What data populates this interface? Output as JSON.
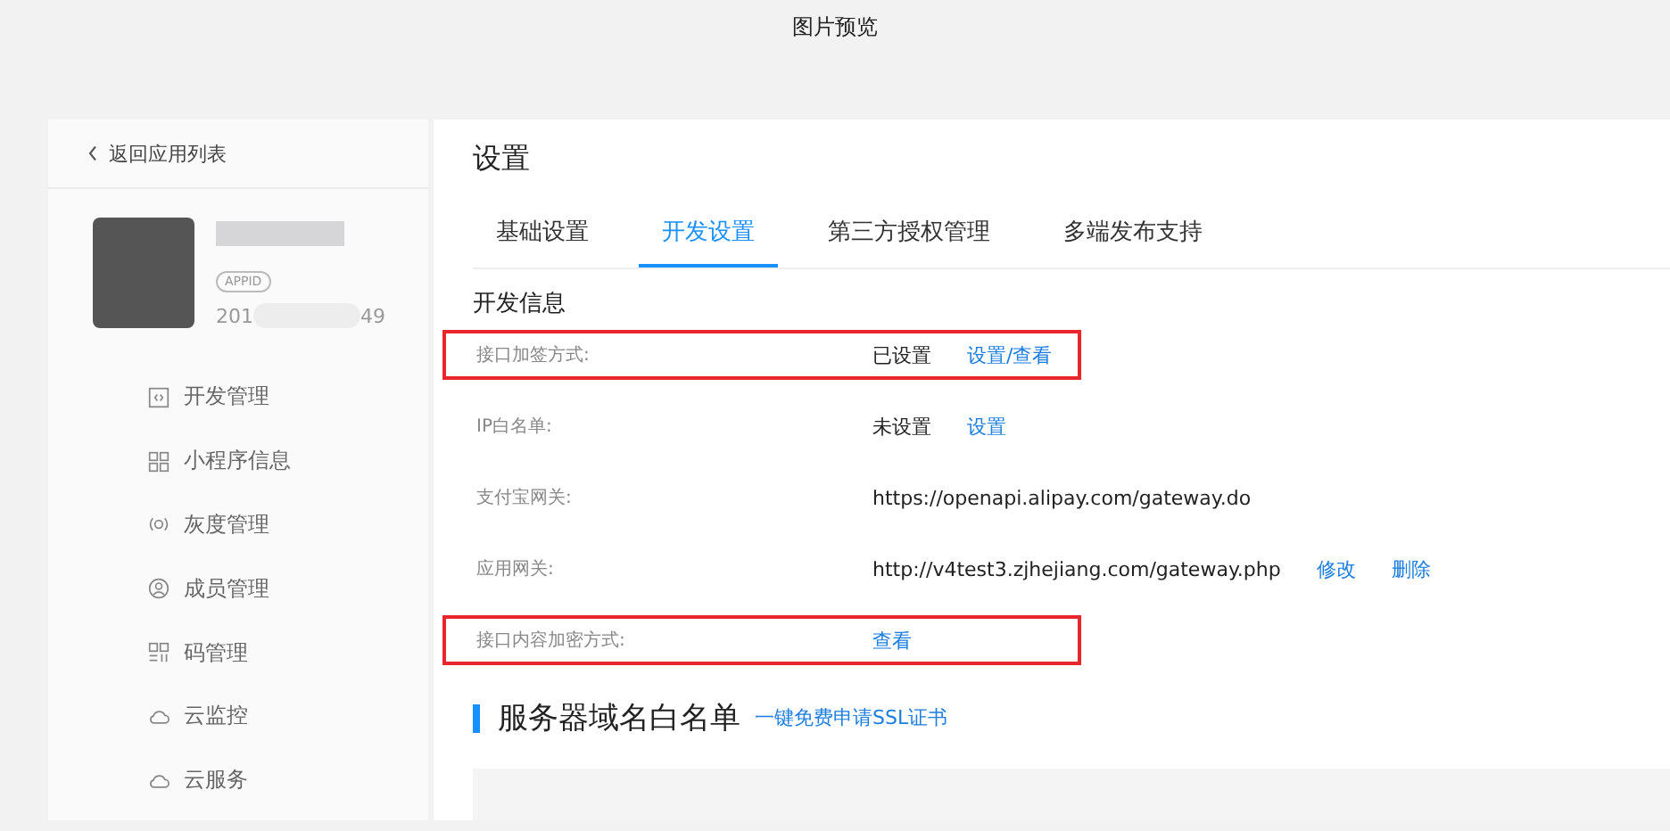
{
  "window": {
    "title": "图片预览"
  },
  "sidebar": {
    "back_link": "返回应用列表",
    "app": {
      "badge": "APPID",
      "appid_start": "201",
      "appid_end": "49"
    },
    "items": [
      {
        "label": "开发管理",
        "kind": "code"
      },
      {
        "label": "小程序信息",
        "kind": "grid"
      },
      {
        "label": "灰度管理",
        "kind": "signal"
      },
      {
        "label": "成员管理",
        "kind": "user"
      },
      {
        "label": "码管理",
        "kind": "qr"
      },
      {
        "label": "云监控",
        "kind": "cloud"
      },
      {
        "label": "云服务",
        "kind": "cloud"
      }
    ]
  },
  "page": {
    "title": "设置",
    "tabs": [
      {
        "label": "基础设置",
        "selected": false
      },
      {
        "label": "开发设置",
        "selected": true
      },
      {
        "label": "第三方授权管理",
        "selected": false
      },
      {
        "label": "多端发布支持",
        "selected": false
      }
    ],
    "section": "开发信息",
    "rows": [
      {
        "label": "接口加签方式:",
        "value": "已设置",
        "links": [
          "设置/查看"
        ],
        "highlighted": true
      },
      {
        "label": "IP白名单:",
        "value": "未设置",
        "links": [
          "设置"
        ],
        "highlighted": false
      },
      {
        "label": "支付宝网关:",
        "value": "https://openapi.alipay.com/gateway.do",
        "links": [],
        "highlighted": false
      },
      {
        "label": "应用网关:",
        "value": "http://v4test3.zjhejiang.com/gateway.php",
        "links": [
          "修改",
          "删除"
        ],
        "highlighted": false
      },
      {
        "label": "接口内容加密方式:",
        "value": "",
        "links": [
          "查看"
        ],
        "highlighted": true
      }
    ],
    "whitelist": {
      "title": "服务器域名白名单",
      "link": "一键免费申请SSL证书"
    }
  }
}
